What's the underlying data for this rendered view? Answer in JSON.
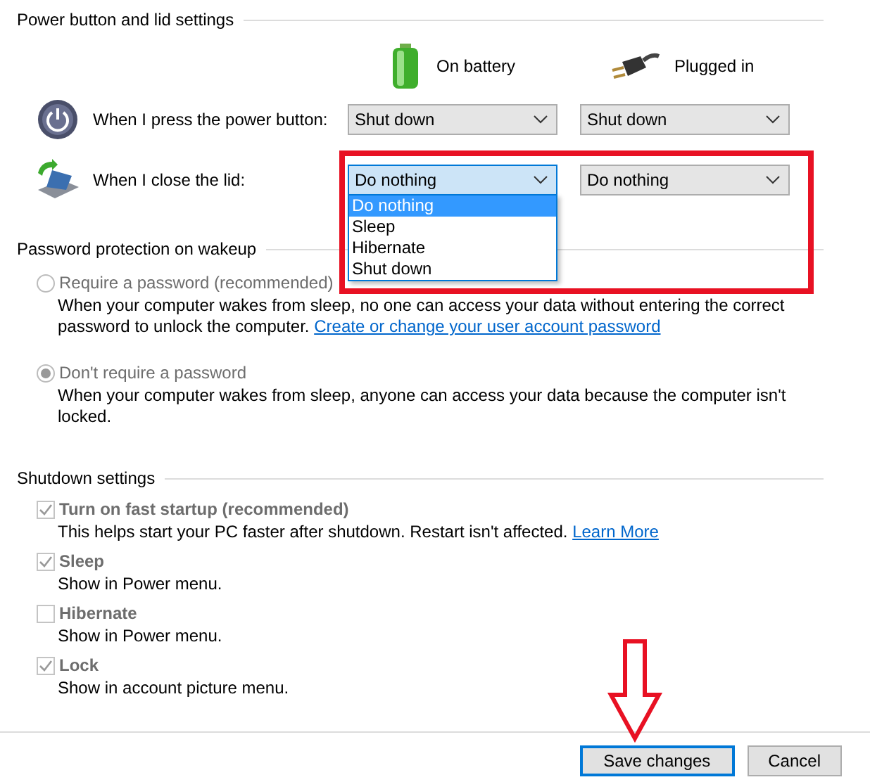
{
  "power": {
    "title": "Power button and lid settings",
    "columns": [
      {
        "label": "On battery",
        "kind": "battery"
      },
      {
        "label": "Plugged in",
        "kind": "plug"
      }
    ],
    "rows": [
      {
        "label": "When I press the power button:",
        "kind": "power",
        "selects": [
          {
            "value": "Shut down",
            "focused": false
          },
          {
            "value": "Shut down",
            "focused": false
          }
        ]
      },
      {
        "label": "When I close the lid:",
        "kind": "lid",
        "highlighted": true,
        "selects": [
          {
            "value": "Do nothing",
            "focused": true,
            "options": [
              {
                "label": "Do nothing",
                "selected": true
              },
              {
                "label": "Sleep",
                "selected": false
              },
              {
                "label": "Hibernate",
                "selected": false
              },
              {
                "label": "Shut down",
                "selected": false
              }
            ]
          },
          {
            "value": "Do nothing",
            "focused": false
          }
        ]
      }
    ]
  },
  "password": {
    "title": "Password protection on wakeup",
    "options": [
      {
        "label": "Require a password (recommended)",
        "selected": false,
        "disabled": true,
        "description": "When your computer wakes from sleep, no one can access your data without entering the correct password to unlock the computer.",
        "link": "Create or change your user account password"
      },
      {
        "label": "Don't require a password",
        "selected": true,
        "disabled": true,
        "description": "When your computer wakes from sleep, anyone can access your data because the computer isn't locked."
      }
    ]
  },
  "shutdown": {
    "title": "Shutdown settings",
    "items": [
      {
        "label": "Turn on fast startup (recommended)",
        "checked": true,
        "disabled": true,
        "description": "This helps start your PC faster after shutdown. Restart isn't affected.",
        "link": "Learn More"
      },
      {
        "label": "Sleep",
        "checked": true,
        "disabled": true,
        "description": "Show in Power menu."
      },
      {
        "label": "Hibernate",
        "checked": false,
        "disabled": true,
        "description": "Show in Power menu."
      },
      {
        "label": "Lock",
        "checked": true,
        "disabled": true,
        "description": "Show in account picture menu."
      }
    ]
  },
  "buttons": [
    {
      "label": "Save changes",
      "default": true,
      "arrow": true
    },
    {
      "label": "Cancel",
      "default": false,
      "arrow": false
    }
  ]
}
